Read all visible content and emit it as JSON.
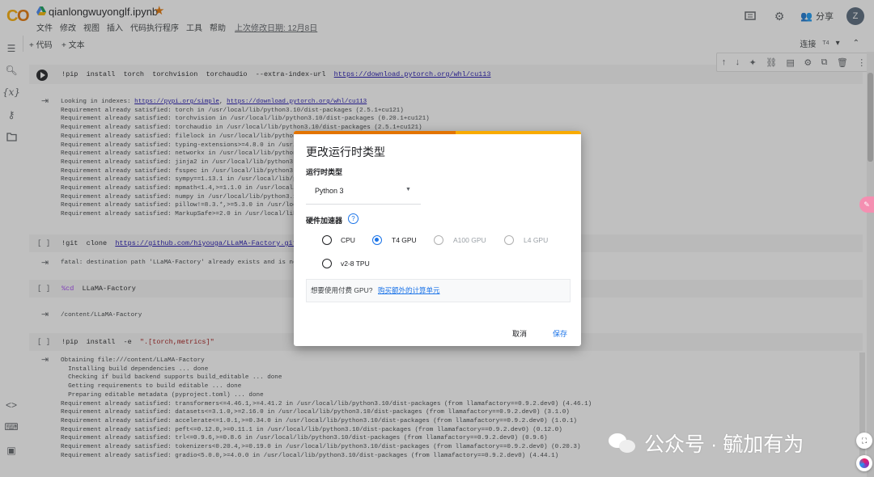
{
  "header": {
    "notebook_title": "qianlongwuyonglf.ipynb",
    "menu": [
      "文件",
      "修改",
      "视图",
      "插入",
      "代码执行程序",
      "工具",
      "帮助"
    ],
    "last_edit": "上次修改日期: 12月8日",
    "share_label": "分享",
    "avatar_letter": "Z"
  },
  "toolbar": {
    "add_code": "+ 代码",
    "add_text": "+ 文本",
    "connect": "连接",
    "runtime_tag": "T4"
  },
  "cells": [
    {
      "code": "!pip  install  torch  torchvision  torchaudio  --extra-index-url  ",
      "code_link": "https://download.pytorch.org/whl/cu113",
      "output_first": "Looking in indexes: ",
      "output_link1": "https://pypi.org/simple",
      "output_link2": "https://download.pytorch.org/whl/cu113",
      "output_lines": [
        "Requirement already satisfied: torch in /usr/local/lib/python3.10/dist-packages (2.5.1+cu121)",
        "Requirement already satisfied: torchvision in /usr/local/lib/python3.10/dist-packages (0.20.1+cu121)",
        "Requirement already satisfied: torchaudio in /usr/local/lib/python3.10/dist-packages (2.5.1+cu121)",
        "Requirement already satisfied: filelock in /usr/local/lib/python3.1",
        "Requirement already satisfied: typing-extensions>=4.8.0 in /usr/loc",
        "Requirement already satisfied: networkx in /usr/local/lib/python3.1",
        "Requirement already satisfied: jinja2 in /usr/local/lib/python3.10/",
        "Requirement already satisfied: fsspec in /usr/local/lib/python3.10/",
        "Requirement already satisfied: sympy==1.13.1 in /usr/local/lib/pyth",
        "Requirement already satisfied: mpmath<1.4,>=1.1.0 in /usr/local/lib",
        "Requirement already satisfied: numpy in /usr/local/lib/python3.10/d",
        "Requirement already satisfied: pillow!=8.3.*,>=5.3.0 in /usr/local/",
        "Requirement already satisfied: MarkupSafe>=2.0 in /usr/local/lib/py"
      ]
    },
    {
      "brackets": "[ ]",
      "code": "!git  clone  ",
      "code_link": "https://github.com/hiyouga/LLaMA-Factory.git",
      "output": "fatal: destination path 'LLaMA-Factory' already exists and is not a"
    },
    {
      "brackets": "[ ]",
      "code_magic": "%cd",
      "code": "  LLaMA-Factory",
      "output": "/content/LLaMA-Factory"
    },
    {
      "brackets": "[ ]",
      "code": "!pip  install  -e  ",
      "code_str": "\".[torch,metrics]\"",
      "output_lines": [
        "Obtaining file:///content/LLaMA-Factory",
        "  Installing build dependencies ... done",
        "  Checking if build backend supports build_editable ... done",
        "  Getting requirements to build editable ... done",
        "  Preparing editable metadata (pyproject.toml) ... done",
        "Requirement already satisfied: transformers<=4.46.1,>=4.41.2 in /usr/local/lib/python3.10/dist-packages (from llamafactory==0.9.2.dev0) (4.46.1)",
        "Requirement already satisfied: datasets<=3.1.0,>=2.16.0 in /usr/local/lib/python3.10/dist-packages (from llamafactory==0.9.2.dev0) (3.1.0)",
        "Requirement already satisfied: accelerate<=1.0.1,>=0.34.0 in /usr/local/lib/python3.10/dist-packages (from llamafactory==0.9.2.dev0) (1.0.1)",
        "Requirement already satisfied: peft<=0.12.0,>=0.11.1 in /usr/local/lib/python3.10/dist-packages (from llamafactory==0.9.2.dev0) (0.12.0)",
        "Requirement already satisfied: trl<=0.9.6,>=0.8.6 in /usr/local/lib/python3.10/dist-packages (from llamafactory==0.9.2.dev0) (0.9.6)",
        "Requirement already satisfied: tokenizers<0.20.4,>=0.19.0 in /usr/local/lib/python3.10/dist-packages (from llamafactory==0.9.2.dev0) (0.20.3)",
        "Requirement already satisfied: gradio<5.0.0,>=4.0.0 in /usr/local/lib/python3.10/dist-packages (from llamafactory==0.9.2.dev0) (4.44.1)"
      ]
    }
  ],
  "dialog": {
    "title": "更改运行时类型",
    "runtime_type_label": "运行时类型",
    "runtime_type_value": "Python 3",
    "hw_label": "硬件加速器",
    "help": "?",
    "options": [
      {
        "label": "CPU",
        "selected": false,
        "disabled": false
      },
      {
        "label": "T4 GPU",
        "selected": true,
        "disabled": false
      },
      {
        "label": "A100 GPU",
        "selected": false,
        "disabled": true
      },
      {
        "label": "L4 GPU",
        "selected": false,
        "disabled": true
      },
      {
        "label": "v2-8 TPU",
        "selected": false,
        "disabled": false
      }
    ],
    "buy_text": "想要使用付费 GPU?",
    "buy_link": "购买额外的计算单元",
    "cancel": "取消",
    "save": "保存"
  },
  "watermark": "公众号 · 毓加有为"
}
